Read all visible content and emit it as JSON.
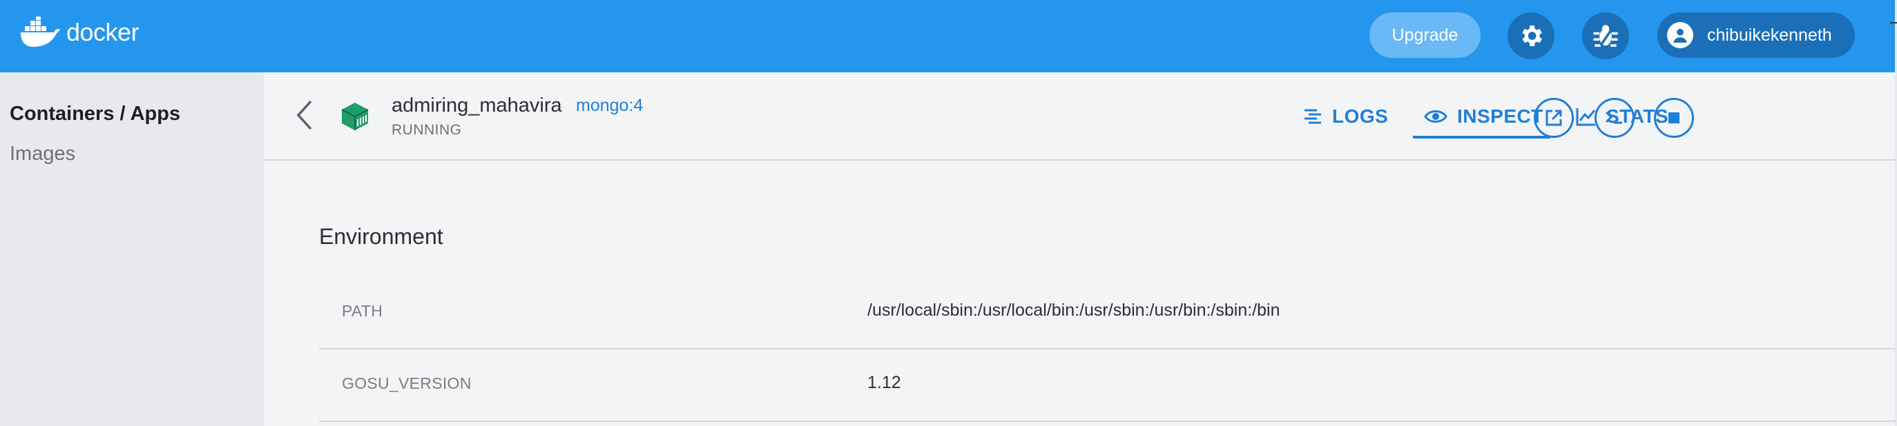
{
  "app": {
    "logo_text": "docker"
  },
  "topbar": {
    "upgrade_label": "Upgrade",
    "settings_icon": "gear-icon",
    "troubleshoot_icon": "bug-icon",
    "user": {
      "name": "chibuikekenneth",
      "avatar_icon": "user-icon"
    }
  },
  "sidebar": {
    "items": [
      {
        "label": "Containers / Apps",
        "active": true
      },
      {
        "label": "Images",
        "active": false
      }
    ]
  },
  "container": {
    "name": "admiring_mahavira",
    "image": "mongo:4",
    "status": "RUNNING"
  },
  "tabs": [
    {
      "label": "LOGS",
      "icon": "logs-icon",
      "active": false
    },
    {
      "label": "INSPECT",
      "icon": "eye-icon",
      "active": true
    },
    {
      "label": "STATS",
      "icon": "chart-icon",
      "active": false
    }
  ],
  "actions": [
    {
      "name": "open-in-browser",
      "icon": "external-link-icon"
    },
    {
      "name": "cli",
      "icon": "terminal-icon"
    },
    {
      "name": "stop",
      "icon": "stop-icon"
    }
  ],
  "environment": {
    "title": "Environment",
    "rows": [
      {
        "key": "PATH",
        "value": "/usr/local/sbin:/usr/local/bin:/usr/sbin:/usr/bin:/sbin:/bin"
      },
      {
        "key": "GOSU_VERSION",
        "value": "1.12"
      }
    ]
  },
  "colors": {
    "brand": "#2496ed",
    "accent": "#1e7fd8",
    "button_dark": "#1a6fb8",
    "running_green": "#1f9d6a"
  }
}
